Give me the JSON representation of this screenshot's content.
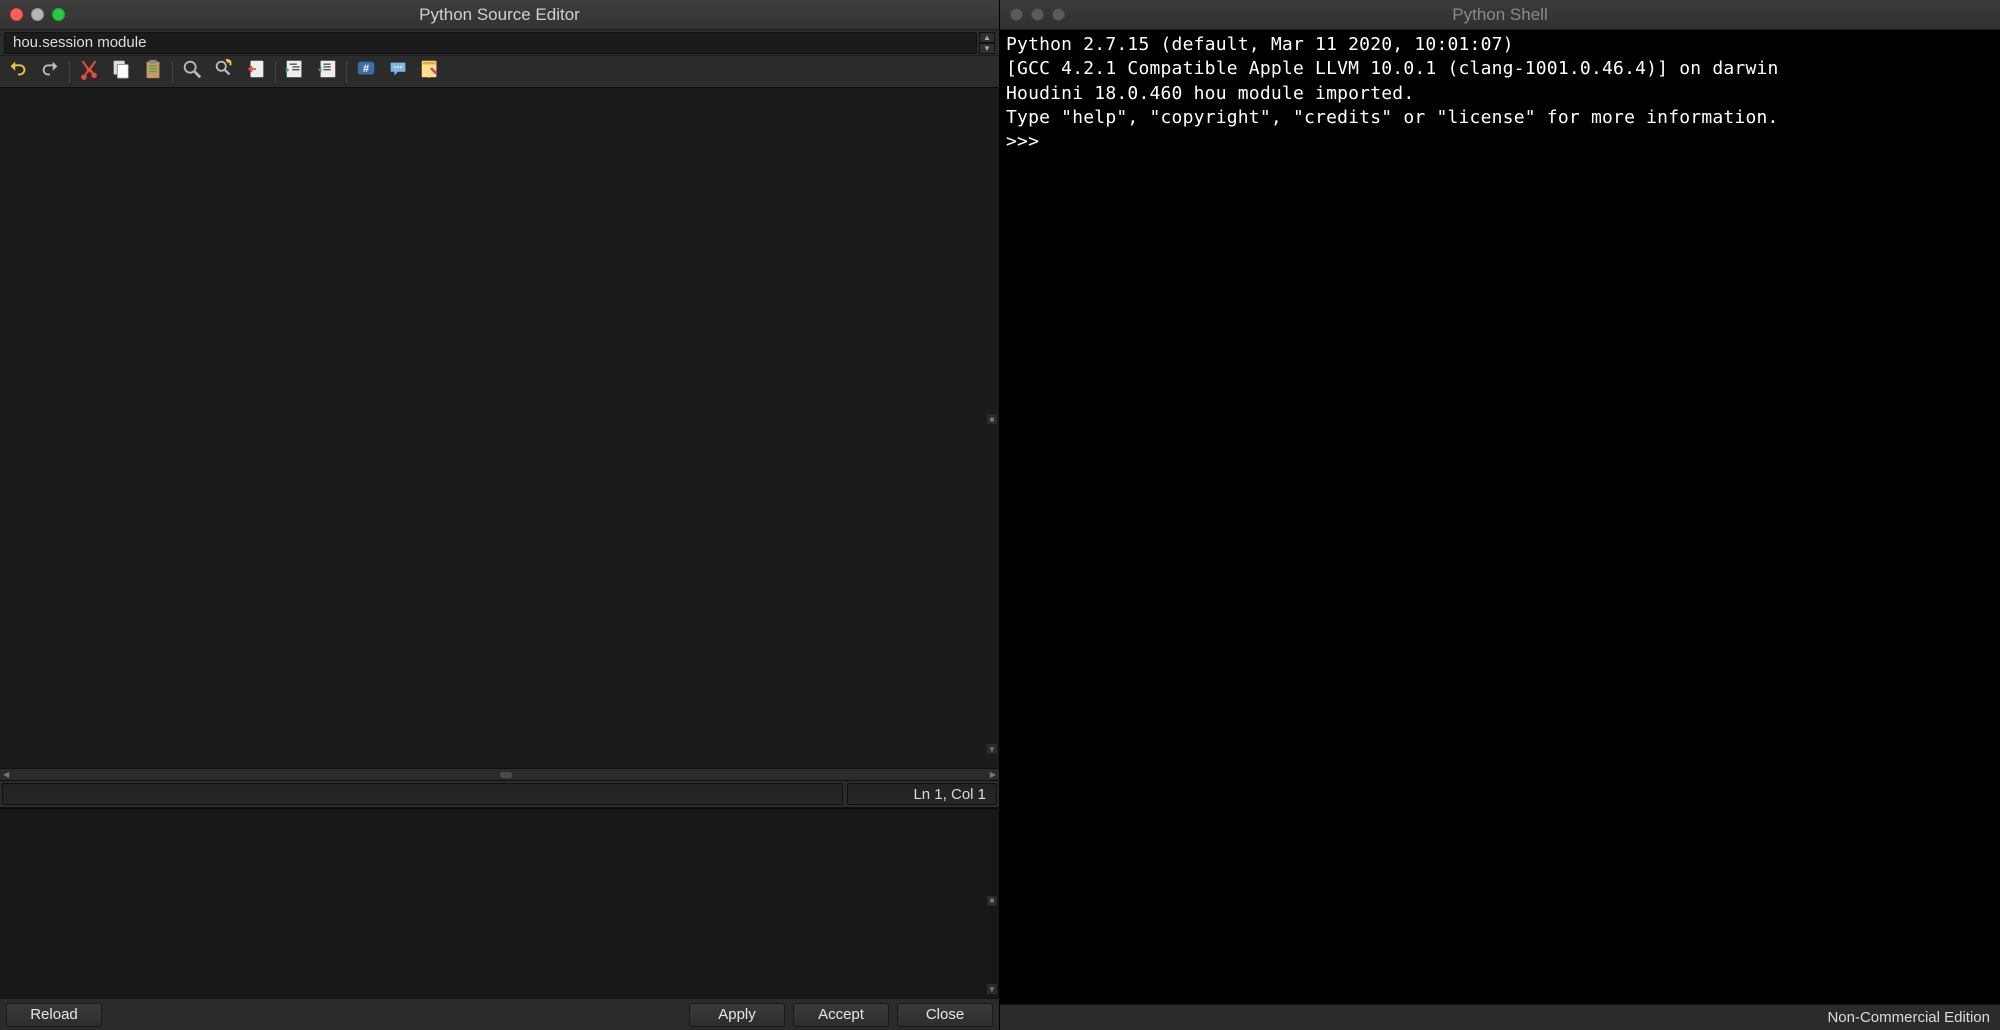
{
  "left": {
    "title": "Python Source Editor",
    "context_field": "hou.session module",
    "toolbar": [
      {
        "name": "undo-icon"
      },
      {
        "name": "redo-icon"
      },
      {
        "sep": true
      },
      {
        "name": "cut-icon"
      },
      {
        "name": "copy-icon"
      },
      {
        "name": "paste-icon"
      },
      {
        "sep": true
      },
      {
        "name": "search-icon"
      },
      {
        "name": "replace-icon"
      },
      {
        "name": "goto-icon"
      },
      {
        "sep": true
      },
      {
        "name": "indent-icon"
      },
      {
        "name": "outdent-icon"
      },
      {
        "sep": true
      },
      {
        "name": "comment-toggle-icon"
      },
      {
        "name": "show-whitespace-icon"
      },
      {
        "name": "external-editor-icon"
      }
    ],
    "status": {
      "lncol": "Ln 1, Col 1"
    },
    "buttons": {
      "reload": "Reload",
      "apply": "Apply",
      "accept": "Accept",
      "close": "Close"
    }
  },
  "right": {
    "title": "Python Shell",
    "lines": [
      "Python 2.7.15 (default, Mar 11 2020, 10:01:07) ",
      "[GCC 4.2.1 Compatible Apple LLVM 10.0.1 (clang-1001.0.46.4)] on darwin",
      "Houdini 18.0.460 hou module imported.",
      "Type \"help\", \"copyright\", \"credits\" or \"license\" for more information.",
      ">>> "
    ],
    "footer": "Non-Commercial Edition"
  }
}
